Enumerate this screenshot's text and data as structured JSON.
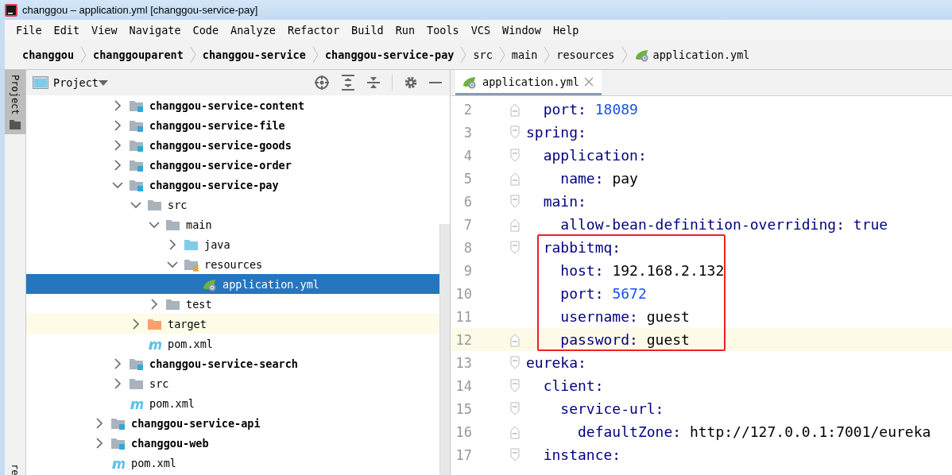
{
  "window": {
    "title": "changgou – application.yml [changgou-service-pay]"
  },
  "menu": [
    {
      "label": "File"
    },
    {
      "label": "Edit"
    },
    {
      "label": "View"
    },
    {
      "label": "Navigate"
    },
    {
      "label": "Code"
    },
    {
      "label": "Analyze"
    },
    {
      "label": "Refactor"
    },
    {
      "label": "Build"
    },
    {
      "label": "Run"
    },
    {
      "label": "Tools"
    },
    {
      "label": "VCS"
    },
    {
      "label": "Window"
    },
    {
      "label": "Help"
    }
  ],
  "breadcrumbs": [
    {
      "label": "changgou",
      "kind": "module"
    },
    {
      "label": "changgouparent",
      "kind": "module"
    },
    {
      "label": "changgou-service",
      "kind": "module"
    },
    {
      "label": "changgou-service-pay",
      "kind": "module"
    },
    {
      "label": "src",
      "kind": "folder"
    },
    {
      "label": "main",
      "kind": "folder"
    },
    {
      "label": "resources",
      "kind": "folder"
    },
    {
      "label": "application.yml",
      "kind": "yaml"
    }
  ],
  "side_stripe": {
    "top": [
      {
        "label": "Project",
        "selected": true
      }
    ],
    "bottom": [
      {
        "label": "re",
        "selected": false
      }
    ]
  },
  "project_panel": {
    "title": "Project",
    "tree": [
      {
        "children": [
          {
            "label": "changgou-service-content",
            "kind": "module",
            "expanded": false,
            "selected": false
          },
          {
            "label": "changgou-service-file",
            "kind": "module",
            "expanded": false,
            "selected": false
          },
          {
            "label": "changgou-service-goods",
            "kind": "module",
            "expanded": false,
            "selected": false
          },
          {
            "label": "changgou-service-order",
            "kind": "module",
            "expanded": false,
            "selected": false
          },
          {
            "label": "changgou-service-pay",
            "kind": "module",
            "expanded": true,
            "selected": false,
            "children": [
              {
                "label": "src",
                "kind": "folder",
                "expanded": true,
                "selected": false,
                "children": [
                  {
                    "label": "main",
                    "kind": "folder",
                    "expanded": true,
                    "selected": false,
                    "children": [
                      {
                        "label": "java",
                        "kind": "source-folder",
                        "expanded": false,
                        "selected": false
                      },
                      {
                        "label": "resources",
                        "kind": "resource-folder",
                        "expanded": true,
                        "selected": false,
                        "children": [
                          {
                            "label": "application.yml",
                            "kind": "yaml",
                            "selected": true
                          }
                        ]
                      }
                    ]
                  },
                  {
                    "label": "test",
                    "kind": "folder",
                    "expanded": false,
                    "selected": false
                  }
                ]
              },
              {
                "label": "target",
                "kind": "excluded-folder",
                "expanded": false,
                "selected": false,
                "highlighted": true
              },
              {
                "label": "pom.xml",
                "kind": "maven",
                "selected": false
              }
            ]
          },
          {
            "label": "changgou-service-search",
            "kind": "module",
            "expanded": false,
            "selected": false
          },
          {
            "label": "src",
            "kind": "folder",
            "expanded": false,
            "selected": false
          },
          {
            "label": "pom.xml",
            "kind": "maven",
            "selected": false
          }
        ]
      },
      {
        "label": "changgou-service-api",
        "kind": "module",
        "expanded": false,
        "selected": false
      },
      {
        "label": "changgou-web",
        "kind": "module",
        "expanded": false,
        "selected": false
      },
      {
        "label": "pom.xml",
        "kind": "maven",
        "selected": false
      }
    ]
  },
  "editor": {
    "tabs": [
      {
        "label": "application.yml",
        "selected": true
      }
    ],
    "lines": [
      {
        "number": "2",
        "key": "  port:",
        "value": "18089",
        "kind": "number",
        "fold_end": true
      },
      {
        "number": "3",
        "key": "spring:",
        "kind": "mapping",
        "fold_start": true
      },
      {
        "number": "4",
        "key": "  application:",
        "kind": "mapping",
        "fold_start": true
      },
      {
        "number": "5",
        "key": "    name:",
        "value": "pay",
        "kind": "string",
        "fold_end": true
      },
      {
        "number": "6",
        "key": "  main:",
        "kind": "mapping",
        "fold_start": true
      },
      {
        "number": "7",
        "key": "    allow-bean-definition-overriding:",
        "value": "true",
        "kind": "keyword",
        "fold_end": true
      },
      {
        "number": "8",
        "key": "  rabbitmq:",
        "kind": "mapping",
        "fold_start": true,
        "boxed": true
      },
      {
        "number": "9",
        "key": "    host:",
        "value": "192.168.2.132",
        "kind": "string",
        "boxed": true
      },
      {
        "number": "10",
        "key": "    port:",
        "value": "5672",
        "kind": "number",
        "boxed": true
      },
      {
        "number": "11",
        "key": "    username:",
        "value": "guest",
        "kind": "string",
        "boxed": true
      },
      {
        "number": "12",
        "key": "    password:",
        "value": "guest",
        "kind": "string",
        "fold_end": true,
        "current": true,
        "boxed": true
      },
      {
        "number": "13",
        "key": "eureka:",
        "kind": "mapping",
        "fold_start": true
      },
      {
        "number": "14",
        "key": "  client:",
        "kind": "mapping",
        "fold_start": true
      },
      {
        "number": "15",
        "key": "    service-url:",
        "kind": "mapping",
        "fold_start": true
      },
      {
        "number": "16",
        "key": "      defaultZone:",
        "value": "http://127.0.0.1:7001/eureka",
        "kind": "string",
        "fold_end": true
      },
      {
        "number": "17",
        "key": "  instance:",
        "kind": "mapping",
        "fold_start": true
      }
    ]
  }
}
